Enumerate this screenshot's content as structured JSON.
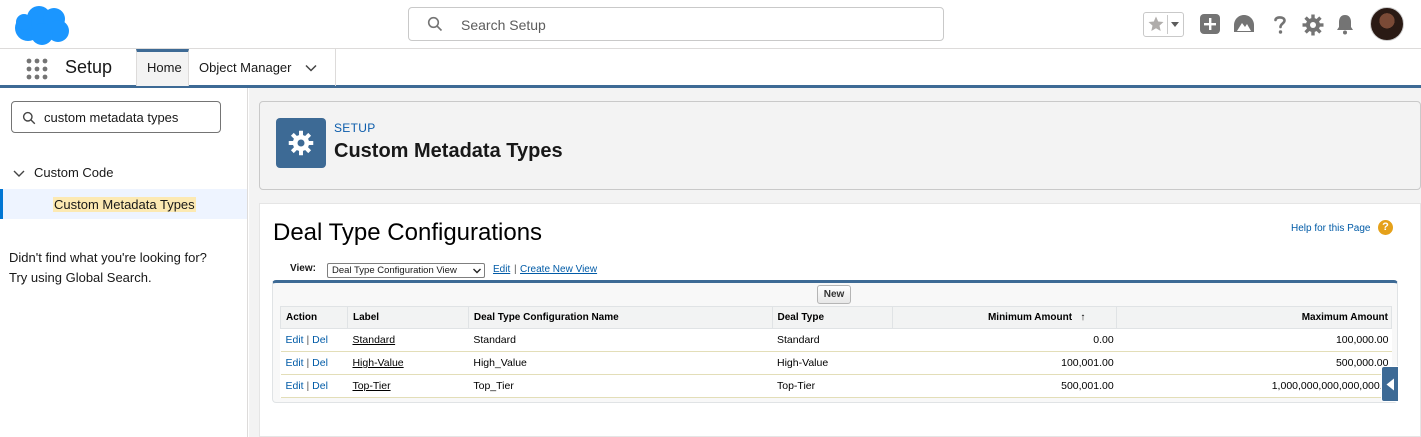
{
  "header": {
    "search_placeholder": "Search Setup"
  },
  "app_nav": {
    "app_name": "Setup",
    "tabs": [
      {
        "label": "Home"
      },
      {
        "label": "Object Manager"
      }
    ]
  },
  "sidebar": {
    "quick_find_value": "custom metadata types",
    "tree": {
      "parent_label": "Custom Code",
      "child_label": "Custom Metadata Types"
    },
    "help_line1": "Didn't find what you're looking for?",
    "help_line2": "Try using Global Search."
  },
  "page_header": {
    "breadcrumb": "SETUP",
    "title": "Custom Metadata Types"
  },
  "list_view": {
    "title": "Deal Type Configurations",
    "help_link": "Help for this Page",
    "view_label": "View:",
    "view_selected": "Deal Type Configuration View",
    "edit_link": "Edit",
    "separator": "|",
    "create_view_link": "Create New View",
    "new_button": "New",
    "columns": [
      "Action",
      "Label",
      "Deal Type Configuration Name",
      "Deal Type",
      "Minimum Amount",
      "Maximum Amount"
    ],
    "sort_indicator": "↑",
    "action_edit": "Edit",
    "action_sep": "|",
    "action_del": "Del",
    "rows": [
      {
        "label": "Standard",
        "name": "Standard",
        "deal_type": "Standard",
        "min": "0.00",
        "max": "100,000.00"
      },
      {
        "label": "High-Value",
        "name": "High_Value",
        "deal_type": "High-Value",
        "min": "100,001.00",
        "max": "500,000.00"
      },
      {
        "label": "Top-Tier",
        "name": "Top_Tier",
        "deal_type": "Top-Tier",
        "min": "500,001.00",
        "max": "1,000,000,000,000,000.0"
      }
    ]
  },
  "colors": {
    "brand_blue": "#3d6a95",
    "link_blue": "#015ba7",
    "salesforce_cloud": "#1b96ff",
    "highlight": "#fce9b2"
  }
}
